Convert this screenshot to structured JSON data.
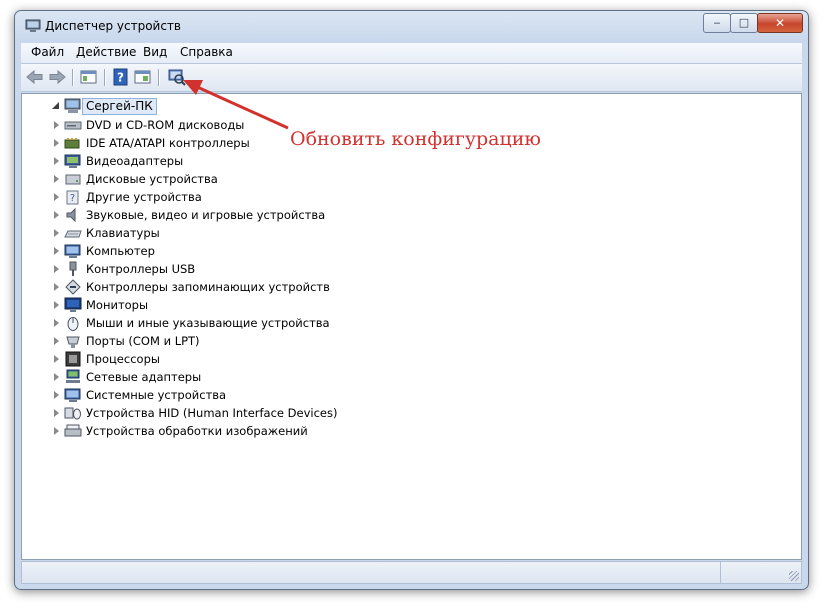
{
  "window": {
    "title": "Диспетчер устройств",
    "controls": {
      "minimize": "‒",
      "maximize": "□",
      "close": "✕"
    }
  },
  "menu": [
    "Файл",
    "Действие",
    "Вид",
    "Справка"
  ],
  "toolbar": {
    "buttons": [
      "back-icon",
      "forward-icon",
      "show-hide-console-tree-icon",
      "help-icon",
      "properties-icon",
      "scan-hardware-changes-icon"
    ]
  },
  "tree": {
    "root": "Сергей-ПК",
    "nodes": [
      {
        "label": "DVD и CD-ROM дисководы",
        "icon": "dvd-drive-icon"
      },
      {
        "label": "IDE ATA/ATAPI контроллеры",
        "icon": "ide-controller-icon"
      },
      {
        "label": "Видеоадаптеры",
        "icon": "display-adapter-icon"
      },
      {
        "label": "Дисковые устройства",
        "icon": "disk-drive-icon"
      },
      {
        "label": "Другие устройства",
        "icon": "unknown-device-icon"
      },
      {
        "label": "Звуковые, видео и игровые устройства",
        "icon": "speaker-icon"
      },
      {
        "label": "Клавиатуры",
        "icon": "keyboard-icon"
      },
      {
        "label": "Компьютер",
        "icon": "computer-icon"
      },
      {
        "label": "Контроллеры USB",
        "icon": "usb-icon"
      },
      {
        "label": "Контроллеры запоминающих устройств",
        "icon": "storage-controller-icon"
      },
      {
        "label": "Мониторы",
        "icon": "monitor-icon"
      },
      {
        "label": "Мыши и иные указывающие устройства",
        "icon": "mouse-icon"
      },
      {
        "label": "Порты (COM и LPT)",
        "icon": "port-icon"
      },
      {
        "label": "Процессоры",
        "icon": "processor-icon"
      },
      {
        "label": "Сетевые адаптеры",
        "icon": "network-adapter-icon"
      },
      {
        "label": "Системные устройства",
        "icon": "system-device-icon"
      },
      {
        "label": "Устройства HID (Human Interface Devices)",
        "icon": "hid-icon"
      },
      {
        "label": "Устройства обработки изображений",
        "icon": "imaging-device-icon"
      }
    ]
  },
  "annotation": {
    "text": "Обновить конфигурацию",
    "color": "#d2322d"
  }
}
